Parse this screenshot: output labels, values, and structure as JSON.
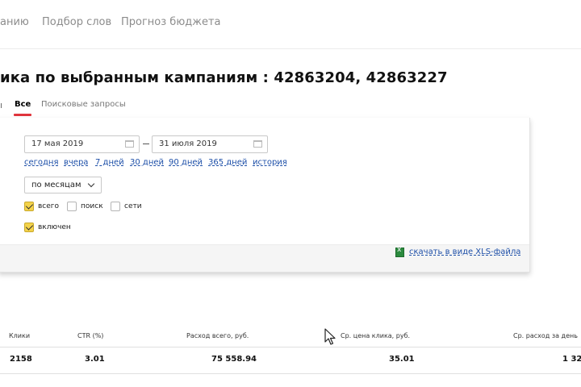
{
  "top_nav": {
    "items": [
      "анию",
      "Подбор слов",
      "Прогноз бюджета"
    ]
  },
  "page_title": "ика по выбранным кампаниям : 42863204, 42863227",
  "tabs": {
    "partial": "ı",
    "active": "Все",
    "other": "Поисковые запросы"
  },
  "filters": {
    "date_from": "17 мая 2019",
    "date_to": "31 июля 2019",
    "quick_links": [
      "сегодня",
      "вчера",
      "7 дней",
      "30 дней",
      "90 дней",
      "365 дней",
      "история"
    ],
    "group_by": "по месяцам",
    "checkboxes_row1": [
      {
        "label": "всего",
        "checked": true
      },
      {
        "label": "поиск",
        "checked": false
      },
      {
        "label": "сети",
        "checked": false
      }
    ],
    "checkboxes_row2": [
      {
        "label": "включен",
        "checked": true
      }
    ],
    "download_label": "скачать в виде XLS-файла"
  },
  "table": {
    "headers": [
      "Клики",
      "CTR (%)",
      "Расход всего, руб.",
      "Ср. цена клика, руб.",
      "Ср. расход за день"
    ],
    "row": [
      "2158",
      "3.01",
      "75 558.94",
      "35.01",
      "1 32"
    ]
  },
  "colors": {
    "accent_red": "#e0353d",
    "link_blue": "#1d4fa8",
    "checkbox_yellow": "#f3d24a",
    "excel_green": "#2b8a3e"
  }
}
